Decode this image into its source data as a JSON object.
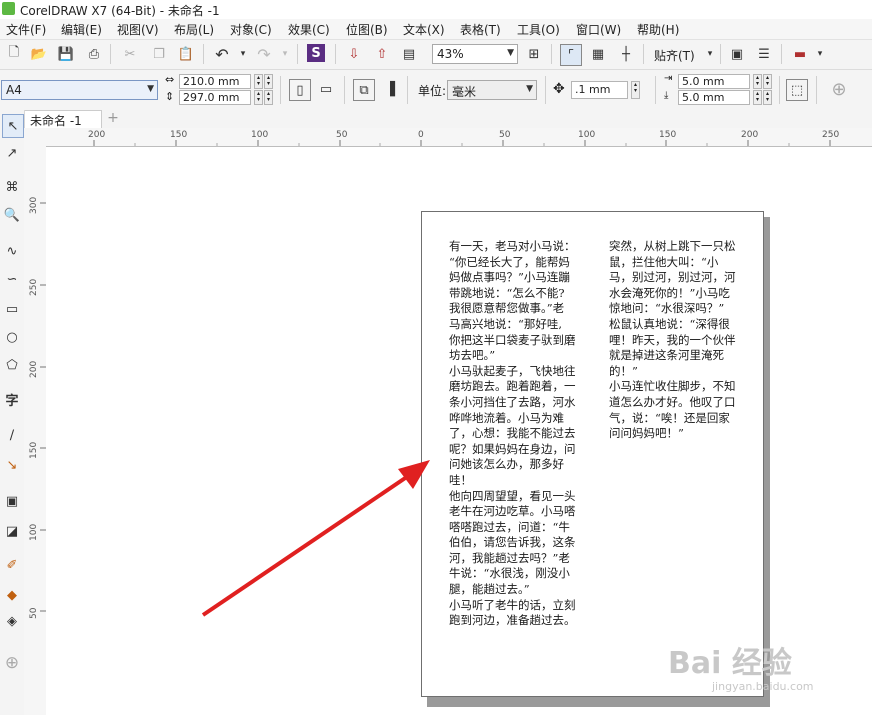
{
  "window": {
    "title": "CorelDRAW X7 (64-Bit) - 未命名 -1"
  },
  "menu": [
    "文件(F)",
    "编辑(E)",
    "视图(V)",
    "布局(L)",
    "对象(C)",
    "效果(C)",
    "位图(B)",
    "文本(X)",
    "表格(T)",
    "工具(O)",
    "窗口(W)",
    "帮助(H)"
  ],
  "toolbar": {
    "zoom_value": "43%",
    "snap_label": "贴齐(T)"
  },
  "property_bar": {
    "page_size": "A4",
    "width": "210.0 mm",
    "height": "297.0 mm",
    "units_label": "单位:",
    "units_value": "毫米",
    "nudge": ".1 mm",
    "dup_x": "5.0 mm",
    "dup_y": "5.0 mm"
  },
  "document": {
    "tab_name": "未命名 -1",
    "add_tab": "+"
  },
  "rulers": {
    "horizontal": [
      "200",
      "150",
      "100",
      "50",
      "0",
      "50",
      "100",
      "150",
      "200",
      "250"
    ],
    "vertical": [
      "300",
      "250",
      "200",
      "150",
      "100",
      "50"
    ]
  },
  "page_text": {
    "left_column": [
      "有一天，老马对小马说：",
      "“你已经长大了，能帮妈",
      "妈做点事吗？”小马连蹦",
      "带跳地说：“怎么不能?",
      "我很愿意帮您做事。”老",
      "马高兴地说：“那好哇,",
      "你把这半口袋麦子驮到磨",
      "坊去吧。”",
      "小马驮起麦子，飞快地往",
      "磨坊跑去。跑着跑着，一",
      "条小河挡住了去路，河水",
      "哗哗地流着。小马为难",
      "了，心想：我能不能过去",
      "呢？如果妈妈在身边，问",
      "问她该怎么办，那多好",
      "哇！",
      "他向四周望望，看见一头",
      "老牛在河边吃草。小马嗒",
      "嗒嗒跑过去，问道：“牛",
      "伯伯，请您告诉我，这条",
      "河，我能趟过去吗？”老",
      "牛说：“水很浅，刚没小",
      "腿，能趟过去。”",
      "小马听了老牛的话，立刻",
      "跑到河边，准备趟过去。"
    ],
    "right_column": [
      "突然，从树上跳下一只松",
      "鼠，拦住他大叫：“小",
      "马，别过河，别过河，河",
      "水会淹死你的！”小马吃",
      "惊地问：“水很深吗？”",
      "松鼠认真地说：“深得很",
      "哩！昨天，我的一个伙伴",
      "就是掉进这条河里淹死",
      "的！”",
      "小马连忙收住脚步，不知",
      "道怎么办才好。他叹了口",
      "气，说：“唉！还是回家",
      "问问妈妈吧！”"
    ]
  },
  "watermark": {
    "main": "Bai 经验",
    "sub": "jingyan.baidu.com"
  },
  "colors": {
    "arrow": "#e02020",
    "page_border": "#6f6f6f",
    "shadow": "#9a9a9a"
  }
}
